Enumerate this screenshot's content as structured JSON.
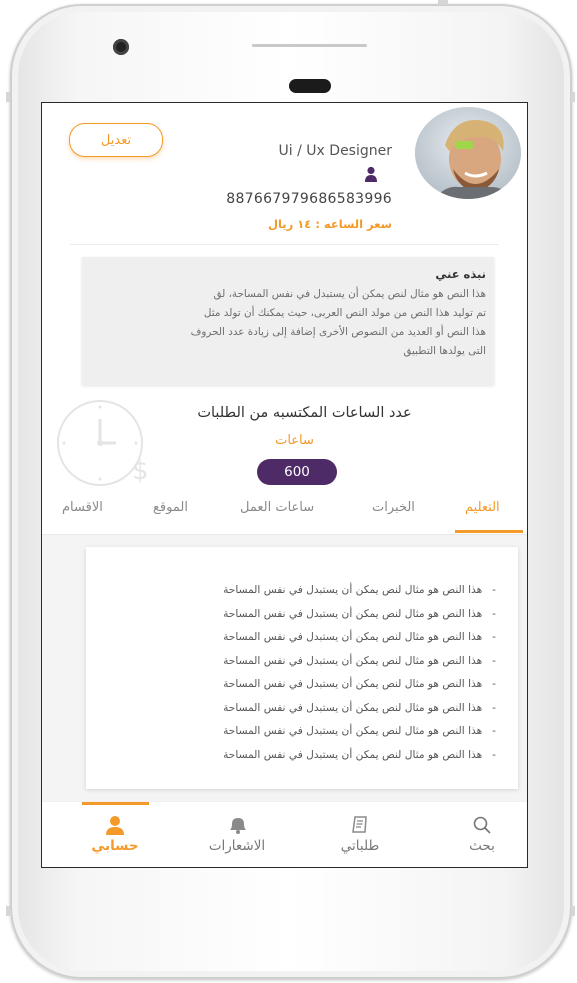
{
  "profile": {
    "edit_label": "تعديل",
    "job_title": "Ui / Ux Designer",
    "phone": "887667979686583996",
    "hourly_rate": "سعر الساعه : ١٤ ريال"
  },
  "about": {
    "title": "نبذه عني",
    "lines": [
      "هذا النص هو مثال لنص يمكن أن يستبدل في نفس المساحة، لق",
      "تم توليد هذا النص من مولد النص العربى، حيث يمكنك أن تولد مثل",
      "هذا النص أو العديد من النصوص الأخرى إضافة إلى زيادة عدد الحروف",
      "التى يولدها التطبيق"
    ]
  },
  "hours": {
    "title": "عدد الساعات المكتسبه من الطلبات",
    "unit": "ساعات",
    "value": "600"
  },
  "tabs": [
    {
      "label": "التعليم",
      "active": true
    },
    {
      "label": "الخبرات",
      "active": false
    },
    {
      "label": "ساعات العمل",
      "active": false
    },
    {
      "label": "الموقع",
      "active": false
    },
    {
      "label": "الاقسام",
      "active": false
    }
  ],
  "education_items": [
    "هذا النص هو مثال لنص يمكن أن يستبدل في نفس المساحة",
    "هذا النص هو مثال لنص يمكن أن يستبدل في نفس المساحة",
    "هذا النص هو مثال لنص يمكن أن يستبدل في نفس المساحة",
    "هذا النص هو مثال لنص يمكن أن يستبدل في نفس المساحة",
    "هذا النص هو مثال لنص يمكن أن يستبدل في نفس المساحة",
    "هذا النص هو مثال لنص يمكن أن يستبدل في نفس المساحة",
    "هذا النص هو مثال لنص يمكن أن يستبدل في نفس المساحة",
    "هذا النص هو مثال لنص يمكن أن يستبدل في نفس المساحة"
  ],
  "nav": [
    {
      "label": "حسابي",
      "icon": "user-icon",
      "active": true
    },
    {
      "label": "الاشعارات",
      "icon": "bell-icon",
      "active": false
    },
    {
      "label": "طلباتي",
      "icon": "orders-icon",
      "active": false
    },
    {
      "label": "بحث",
      "icon": "search-icon",
      "active": false
    }
  ],
  "colors": {
    "accent": "#f39a2a",
    "purple": "#4e2a67"
  }
}
